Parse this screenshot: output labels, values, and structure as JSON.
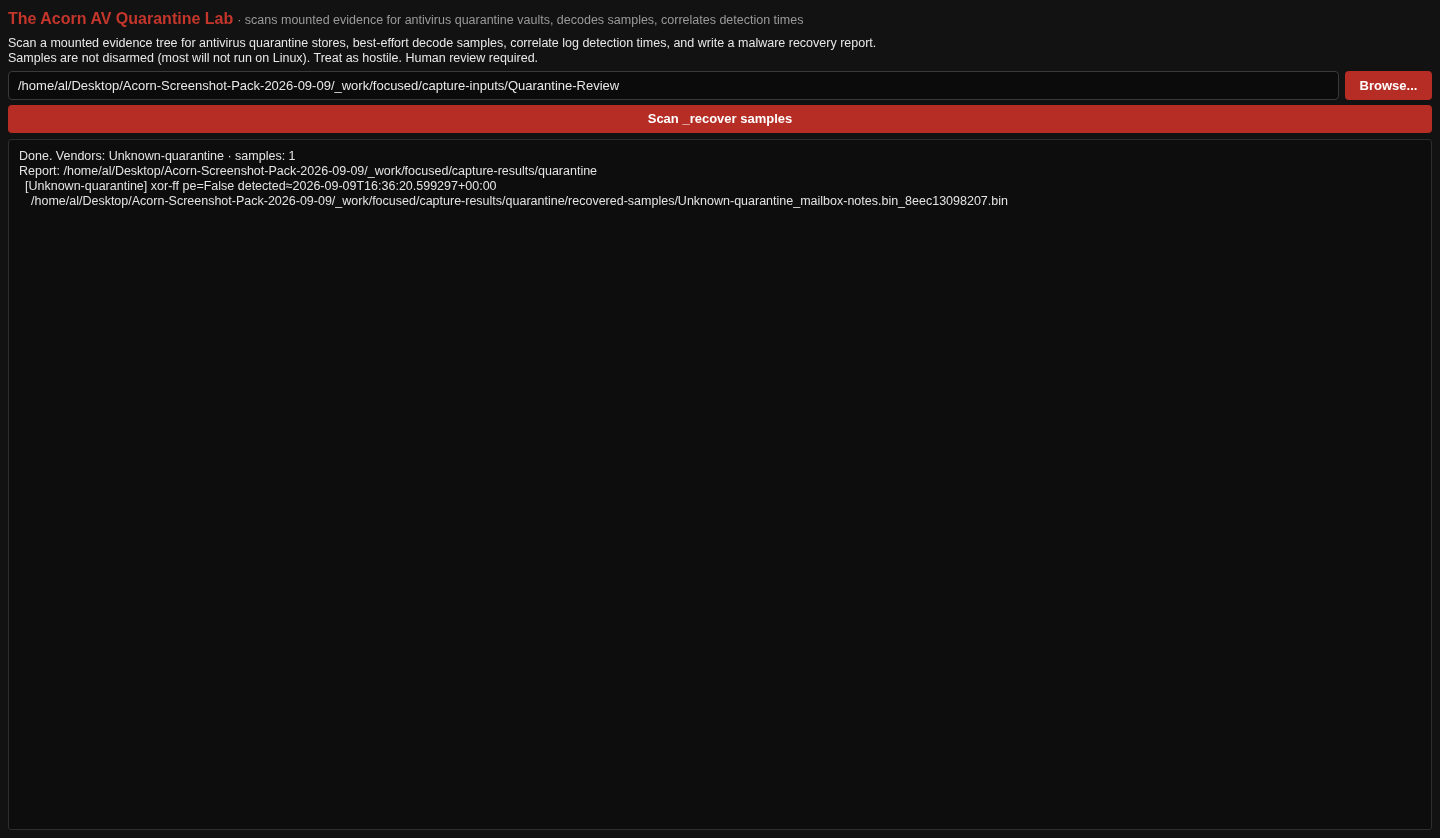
{
  "header": {
    "title": "The Acorn AV Quarantine Lab",
    "subtitle": "· scans mounted evidence for antivirus quarantine vaults, decodes samples, correlates detection times"
  },
  "description": [
    "Scan a mounted evidence tree for antivirus quarantine stores, best-effort decode samples, correlate log detection times, and write a malware recovery report.",
    "Samples are not disarmed (most will not run on Linux). Treat as hostile. Human review required."
  ],
  "path_field": {
    "value": "/home/al/Desktop/Acorn-Screenshot-Pack-2026-09-09/_work/focused/capture-inputs/Quarantine-Review"
  },
  "browse_button": {
    "label": "Browse..."
  },
  "scan_button": {
    "label": "Scan _recover samples"
  },
  "output": {
    "lines": [
      {
        "text": "Done. Vendors: Unknown-quarantine · samples: 1"
      },
      {
        "text": "Report: /home/al/Desktop/Acorn-Screenshot-Pack-2026-09-09/_work/focused/capture-results/quarantine",
        "children": [
          {
            "text": "[Unknown-quarantine] xor-ff pe=False detected≈2026-09-09T16:36:20.599297+00:00",
            "children": [
              {
                "text": "/home/al/Desktop/Acorn-Screenshot-Pack-2026-09-09/_work/focused/capture-results/quarantine/recovered-samples/Unknown-quarantine_mailbox-notes.bin_8eec13098207.bin"
              }
            ]
          }
        ]
      }
    ]
  }
}
